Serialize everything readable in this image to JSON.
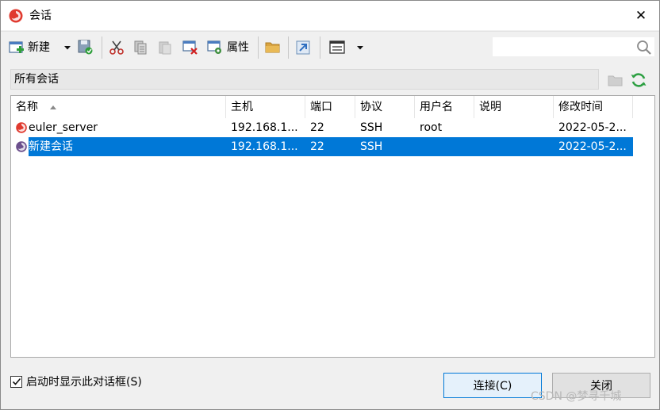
{
  "window": {
    "title": "会话",
    "close_glyph": "✕"
  },
  "toolbar": {
    "new_label": "新建",
    "properties_label": "属性",
    "search_placeholder": ""
  },
  "path": {
    "label": "所有会话"
  },
  "table": {
    "columns": [
      "名称",
      "主机",
      "端口",
      "协议",
      "用户名",
      "说明",
      "修改时间"
    ],
    "rows": [
      {
        "name": "euler_server",
        "host": "192.168.1...",
        "port": "22",
        "protocol": "SSH",
        "user": "root",
        "desc": "",
        "modified": "2022-05-2..."
      },
      {
        "name": "新建会话",
        "host": "192.168.1...",
        "port": "22",
        "protocol": "SSH",
        "user": "",
        "desc": "",
        "modified": "2022-05-2..."
      }
    ]
  },
  "footer": {
    "startup_checkbox_label": "启动时显示此对话框(S)",
    "connect_label": "连接(C)",
    "close_label": "关闭",
    "watermark": "CSDN @梦寻千城"
  },
  "colors": {
    "selection": "#0078d7",
    "accent_red": "#d9302c"
  }
}
